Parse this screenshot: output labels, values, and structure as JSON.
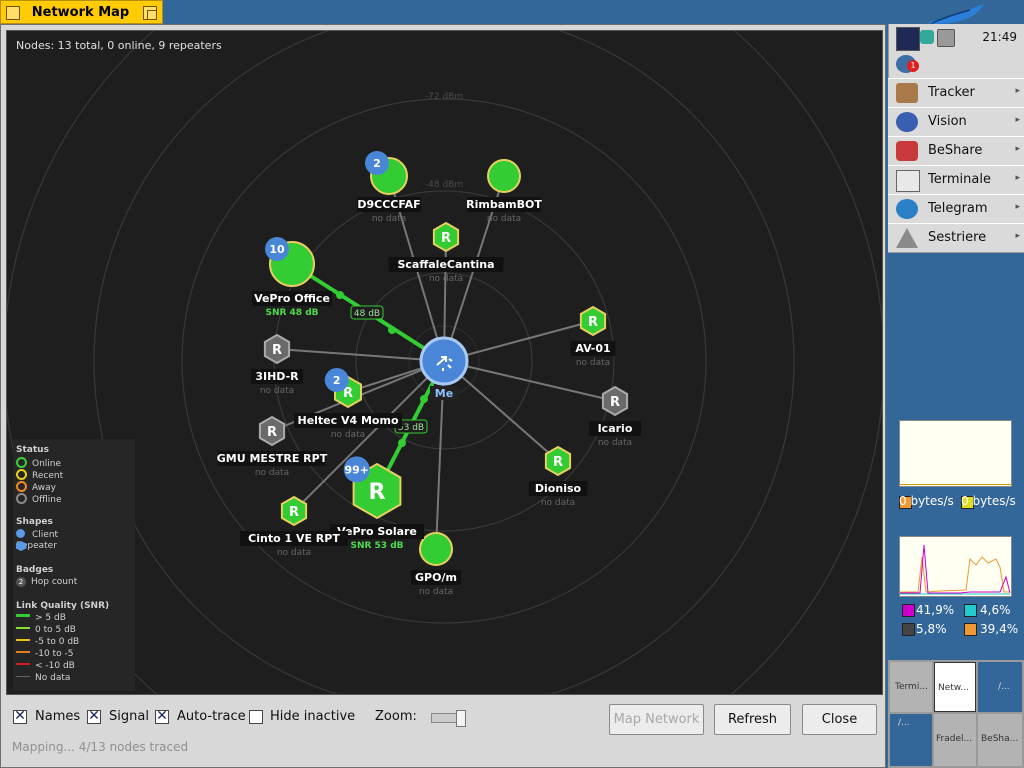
{
  "window": {
    "title": "Network Map"
  },
  "map": {
    "header": "Nodes: 13 total, 0 online, 9 repeaters",
    "ring_labels": [
      "-72 dBm",
      "-48 dBm"
    ],
    "me_label": "Me",
    "link_labels": [
      "48 dB",
      "53 dB"
    ],
    "nodes": [
      {
        "id": "d9cccfaf",
        "name": "D9CCCFAF",
        "sub": "no data",
        "badge": "2",
        "kind": "client"
      },
      {
        "id": "rimbambot",
        "name": "RimbamBOT",
        "sub": "no data",
        "badge": "",
        "kind": "client"
      },
      {
        "id": "scaffalecantina",
        "name": "ScaffaleCantina",
        "sub": "no data",
        "badge": "",
        "kind": "repeater",
        "glyph": "R"
      },
      {
        "id": "vepro-office",
        "name": "VePro Office",
        "sub": "SNR 48 dB",
        "badge": "10",
        "kind": "client"
      },
      {
        "id": "av01",
        "name": "AV-01",
        "sub": "no data",
        "badge": "",
        "kind": "repeater",
        "glyph": "R"
      },
      {
        "id": "3ihd-r",
        "name": "3IHD-R",
        "sub": "no data",
        "badge": "",
        "kind": "repeater",
        "glyph": "R"
      },
      {
        "id": "heltec",
        "name": "Heltec V4 Momo",
        "sub": "no data",
        "badge": "2",
        "kind": "repeater",
        "glyph": "R"
      },
      {
        "id": "icario",
        "name": "Icario",
        "sub": "no data",
        "badge": "",
        "kind": "repeater",
        "glyph": "R"
      },
      {
        "id": "gmu",
        "name": "GMU MESTRE RPT",
        "sub": "no data",
        "badge": "",
        "kind": "repeater",
        "glyph": "R"
      },
      {
        "id": "dioniso",
        "name": "Dioniso",
        "sub": "no data",
        "badge": "",
        "kind": "repeater",
        "glyph": "R"
      },
      {
        "id": "vepro-solare",
        "name": "VePro Solare",
        "sub": "SNR 53 dB",
        "badge": "99+",
        "kind": "repeater",
        "glyph": "R"
      },
      {
        "id": "cinto",
        "name": "Cinto 1 VE RPT",
        "sub": "no data",
        "badge": "",
        "kind": "repeater",
        "glyph": "R"
      },
      {
        "id": "gpo",
        "name": "GPO/m",
        "sub": "no data",
        "badge": "",
        "kind": "client"
      }
    ]
  },
  "legend": {
    "status_title": "Status",
    "status": [
      {
        "label": "Online",
        "color": "#3ccf3c"
      },
      {
        "label": "Recent",
        "color": "#e8d020"
      },
      {
        "label": "Away",
        "color": "#f08a20"
      },
      {
        "label": "Offline",
        "color": "#8a8a8a"
      }
    ],
    "shapes_title": "Shapes",
    "shapes": [
      "Client",
      "Repeater"
    ],
    "badges_title": "Badges",
    "badge_example": "2",
    "badge_text": "Hop count",
    "lq_title": "Link Quality (SNR)",
    "lq": [
      {
        "label": "> 5 dB",
        "color": "#33cc33"
      },
      {
        "label": "0 to 5 dB",
        "color": "#88dd33"
      },
      {
        "label": "-5 to 0 dB",
        "color": "#e8c020"
      },
      {
        "label": "-10 to -5",
        "color": "#e08020"
      },
      {
        "label": "< -10 dB",
        "color": "#cc2020"
      },
      {
        "label": "No data",
        "color": "#666666"
      }
    ]
  },
  "controls": {
    "names_label": "Names",
    "signal_label": "Signal",
    "autotrace_label": "Auto-trace",
    "hide_inactive_label": "Hide inactive",
    "zoom_label": "Zoom:",
    "map_network_button": "Map Network",
    "refresh_button": "Refresh",
    "close_button": "Close",
    "status_text": "Mapping... 4/13 nodes traced"
  },
  "deskbar": {
    "clock": "21:49",
    "notify_count": "1",
    "apps": [
      {
        "label": "Tracker",
        "icon": "tracker-icon"
      },
      {
        "label": "Vision",
        "icon": "vision-icon"
      },
      {
        "label": "BeShare",
        "icon": "beshare-icon"
      },
      {
        "label": "Terminale",
        "icon": "terminal-icon"
      },
      {
        "label": "Telegram",
        "icon": "telegram-icon"
      },
      {
        "label": "Sestriere",
        "icon": "sestriere-icon"
      }
    ],
    "net_in": "0 bytes/s",
    "net_out": "0 bytes/s",
    "cpu": [
      {
        "value": "41,9%",
        "color": "#cc00cc"
      },
      {
        "value": "4,6%",
        "color": "#22cccc"
      },
      {
        "value": "5,8%",
        "color": "#444444"
      },
      {
        "value": "39,4%",
        "color": "#ee9933"
      }
    ],
    "workspaces": [
      "Termi...",
      "Netw...",
      "/...",
      "/...",
      "Fradel...",
      "BeSha..."
    ]
  }
}
